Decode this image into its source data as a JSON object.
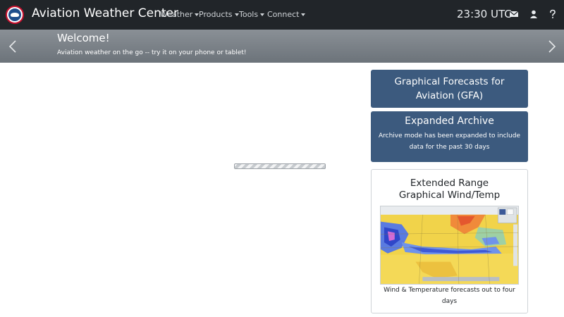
{
  "navbar": {
    "brand": "Aviation Weather Center",
    "menu": [
      {
        "label": "Weather"
      },
      {
        "label": "Products"
      },
      {
        "label": "Tools"
      },
      {
        "label": "Connect"
      }
    ],
    "time": "23:30 UTC",
    "icons": [
      "envelope-icon",
      "user-icon",
      "help-icon"
    ],
    "bg_color": "#212529"
  },
  "banner": {
    "title": "Welcome!",
    "text": "Aviation weather on the go -- try it on your phone or tablet!"
  },
  "cards": {
    "gfa": {
      "title_line1": "Graphical Forecasts for",
      "title_line2": "Aviation (GFA)"
    },
    "archive": {
      "title": "Expanded Archive",
      "desc_line1": "Archive mode has been expanded to include",
      "desc_line2": "data for the past 30 days"
    },
    "extended": {
      "title_line1": "Extended Range",
      "title_line2": "Graphical Wind/Temp",
      "desc_line1": "Wind & Temperature forecasts out to four",
      "desc_line2": "days"
    },
    "accent_color": "#3c5a7e"
  }
}
